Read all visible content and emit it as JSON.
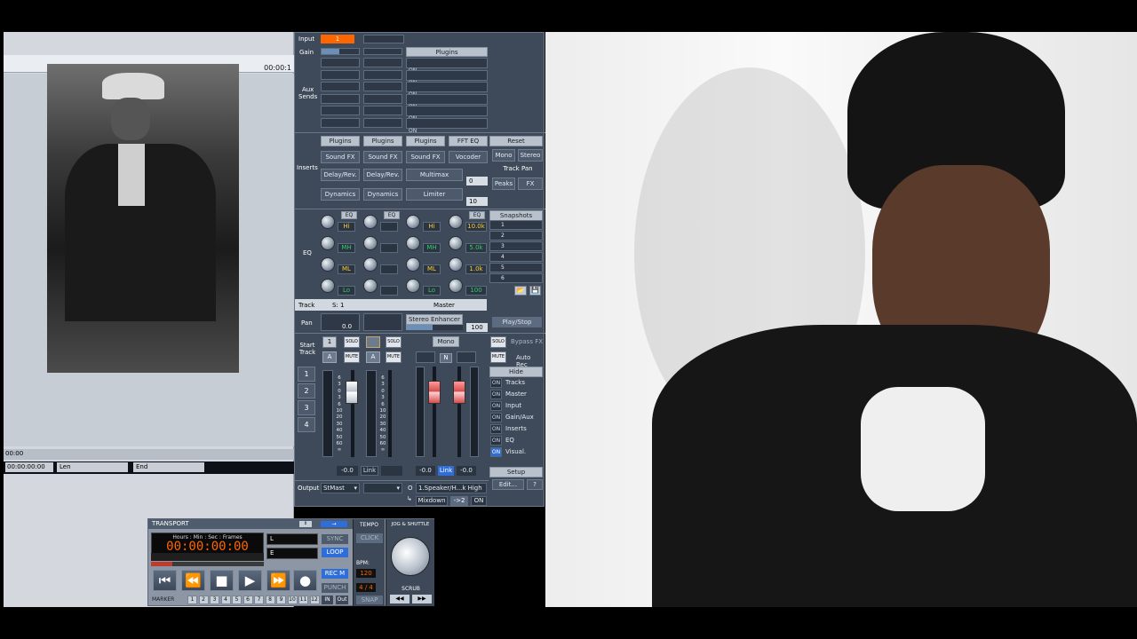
{
  "timeline": {
    "time_top_right": "00:00:1",
    "time_bottom": "00:00",
    "start_time": "00:00:00:00",
    "len_label": "Len",
    "end_label": "End"
  },
  "mixer": {
    "input_label": "Input",
    "input_value": "1",
    "gain_label": "Gain",
    "aux_label_1": "Aux",
    "aux_label_2": "Sends",
    "plugins_header": "Plugins",
    "on_labels": [
      "ON",
      "ON",
      "ON",
      "ON",
      "ON",
      "ON"
    ],
    "inserts_label": "Inserts",
    "insert_cols": [
      {
        "plugins": "Plugins",
        "fx": "Sound FX",
        "delay": "Delay/Rev.",
        "dyn": "Dynamics"
      },
      {
        "plugins": "Plugins",
        "fx": "Sound FX",
        "delay": "Delay/Rev.",
        "dyn": "Dynamics"
      },
      {
        "plugins": "Plugins",
        "fx": "Sound FX",
        "delay": "Multimax",
        "dyn": "Limiter"
      }
    ],
    "fft_eq": "FFT EQ",
    "vocoder": "Vocoder",
    "insert_val_0": "0",
    "insert_val_10": "10",
    "reset": "Reset",
    "mono": "Mono",
    "stereo": "Stereo",
    "track_pan": "Track Pan",
    "peaks": "Peaks",
    "fx": "FX",
    "eq_label": "EQ",
    "eq_btn": "EQ",
    "eq_bands": [
      "Hi",
      "MH",
      "ML",
      "Lo"
    ],
    "eq_values": [
      "10.0k",
      "5.0k",
      "1.0k",
      "100"
    ],
    "snapshots": "Snapshots",
    "snapshot_items": [
      "1",
      "2",
      "3",
      "4",
      "5",
      "6"
    ],
    "track_label": "Track",
    "track_num": "S: 1",
    "master_label": "Master",
    "pan_label": "Pan",
    "pan_value": "0.0",
    "stereo_enhancer": "Stereo Enhancer",
    "stereo_value": "100",
    "play_stop": "Play/Stop",
    "start_track_1": "Start",
    "start_track_2": "Track",
    "track_one": "1",
    "solo": "SOLO",
    "mute": "MUTE",
    "a": "A",
    "n": "N",
    "mono2": "Mono",
    "bypass_fx": "Bypass FX",
    "auto_rec": "Auto Rec",
    "hide": "Hide",
    "hide_items": [
      {
        "tag": "ON",
        "label": "Tracks"
      },
      {
        "tag": "ON",
        "label": "Master"
      },
      {
        "tag": "ON",
        "label": "Input"
      },
      {
        "tag": "ON",
        "label": "Gain/Aux"
      },
      {
        "tag": "ON",
        "label": "Inserts"
      },
      {
        "tag": "ON",
        "label": "EQ"
      },
      {
        "tag": "ON",
        "label": "Visual."
      }
    ],
    "side_nums": [
      "1",
      "2",
      "3",
      "4"
    ],
    "meter_scale": [
      "6",
      "3",
      "0",
      "3",
      "6",
      "10",
      "20",
      "30",
      "40",
      "50",
      "60",
      "∞"
    ],
    "db_left": "-0.0",
    "link": "Link",
    "db_m1": "-0.0",
    "db_m2": "-0.0",
    "setup": "Setup",
    "edit": "Edit...",
    "help": "?",
    "output_label": "Output",
    "output_value": "StMast",
    "output_device": "1.Speaker/H...k High",
    "mixdown": "Mixdown",
    "mix_arrow": "->2",
    "on_tag": "ON",
    "o_label": "O"
  },
  "transport": {
    "title": "TRANSPORT",
    "format_header": "Hours : Min : Sec : Frames",
    "time": "00:00:00:00",
    "time_format": "TIME FORMAT",
    "smpte": "SMPTE 25",
    "l": "L",
    "e": "E",
    "sync": "SYNC",
    "loop": "LOOP",
    "recm": "REC M",
    "punch": "PUNCH",
    "marker": "MARKER",
    "markers": [
      "1",
      "2",
      "3",
      "4",
      "5",
      "6",
      "7",
      "8",
      "9",
      "10",
      "11",
      "12"
    ],
    "in": "IN",
    "out": "Out",
    "tempo": "TEMPO",
    "click": "CLICK",
    "bpm_label": "BPM:",
    "bpm": "120",
    "sig": "4 / 4",
    "snap": "SNAP",
    "jog": "JOG & SHUTTLE",
    "scrub": "SCRUB"
  },
  "colors": {
    "accent": "#ff6600",
    "panel": "#3e4a5a",
    "active_blue": "#2f6ed8"
  }
}
